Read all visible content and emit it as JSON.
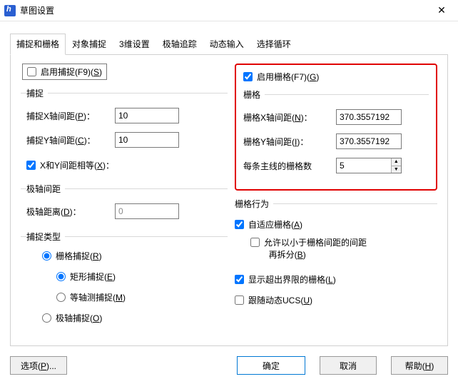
{
  "window": {
    "title": "草图设置"
  },
  "tabs": [
    "捕捉和栅格",
    "对象捕捉",
    "3维设置",
    "极轴追踪",
    "动态输入",
    "选择循环"
  ],
  "left": {
    "enableSnap": {
      "label": "启用捕捉(F9)(",
      "hot": "S",
      "tail": ")",
      "checked": false
    },
    "snapGroup": "捕捉",
    "snapX": {
      "label": "捕捉X轴间距(",
      "hot": "P",
      "tail": ")：",
      "value": "10"
    },
    "snapY": {
      "label": "捕捉Y轴间距(",
      "hot": "C",
      "tail": ")：",
      "value": "10"
    },
    "equalXY": {
      "label": "X和Y间距相等(",
      "hot": "X",
      "tail": ")：",
      "checked": true
    },
    "polarGroup": "极轴间距",
    "polarDist": {
      "label": "极轴距离(",
      "hot": "D",
      "tail": ")：",
      "value": "0",
      "disabled": true
    },
    "typeGroup": "捕捉类型",
    "gridSnap": {
      "label": "栅格捕捉(",
      "hot": "R",
      "tail": ")",
      "checked": true
    },
    "rectSnap": {
      "label": "矩形捕捉(",
      "hot": "E",
      "tail": ")",
      "checked": true
    },
    "isoSnap": {
      "label": "等轴测捕捉(",
      "hot": "M",
      "tail": ")",
      "checked": false
    },
    "polarSnap": {
      "label": "极轴捕捉(",
      "hot": "O",
      "tail": ")",
      "checked": false
    }
  },
  "right": {
    "enableGrid": {
      "label": "启用栅格(F7)(",
      "hot": "G",
      "tail": ")",
      "checked": true
    },
    "gridGroup": "栅格",
    "gridX": {
      "label": "栅格X轴间距(",
      "hot": "N",
      "tail": ")：",
      "value": "370.3557192"
    },
    "gridY": {
      "label": "栅格Y轴间距(",
      "hot": "I",
      "tail": ")：",
      "value": "370.3557192"
    },
    "major": {
      "label": "每条主线的栅格数",
      "value": "5"
    },
    "behaviorGroup": "栅格行为",
    "adaptive": {
      "label": "自适应栅格(",
      "hot": "A",
      "tail": ")",
      "checked": true
    },
    "subdivide": {
      "line1": "允许以小于栅格间距的间距",
      "line2pre": "再拆分(",
      "hot": "B",
      "line2post": ")",
      "checked": false
    },
    "beyond": {
      "label": "显示超出界限的栅格(",
      "hot": "L",
      "tail": ")",
      "checked": true
    },
    "dynUCS": {
      "label": "跟随动态UCS(",
      "hot": "U",
      "tail": ")",
      "checked": false
    }
  },
  "footer": {
    "options": {
      "label": "选项(",
      "hot": "P",
      "tail": ")..."
    },
    "ok": "确定",
    "cancel": "取消",
    "help": {
      "label": "帮助(",
      "hot": "H",
      "tail": ")"
    }
  }
}
